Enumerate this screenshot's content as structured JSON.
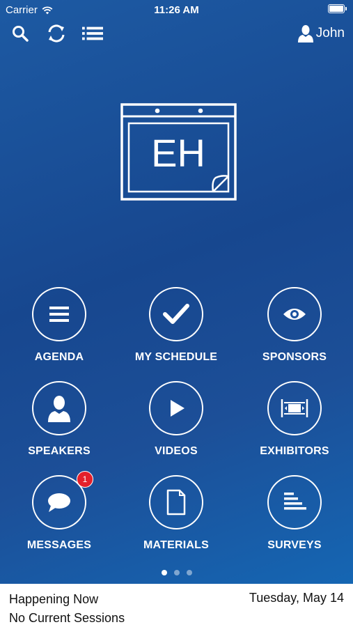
{
  "status_bar": {
    "carrier": "Carrier",
    "time": "11:26 AM"
  },
  "nav": {
    "search_icon": "search-icon",
    "refresh_icon": "refresh-icon",
    "list_icon": "list-icon",
    "user_name": "John"
  },
  "logo": {
    "text": "EH"
  },
  "tiles": [
    {
      "label": "AGENDA",
      "icon": "agenda-icon"
    },
    {
      "label": "MY SCHEDULE",
      "icon": "checkmark-icon"
    },
    {
      "label": "SPONSORS",
      "icon": "eye-icon"
    },
    {
      "label": "SPEAKERS",
      "icon": "person-icon"
    },
    {
      "label": "VIDEOS",
      "icon": "play-icon"
    },
    {
      "label": "EXHIBITORS",
      "icon": "booth-icon"
    },
    {
      "label": "MESSAGES",
      "icon": "chat-bubble-icon",
      "badge": "1"
    },
    {
      "label": "MATERIALS",
      "icon": "document-icon"
    },
    {
      "label": "SURVEYS",
      "icon": "survey-lines-icon"
    }
  ],
  "pager": {
    "pages": 3,
    "current": 1
  },
  "footer": {
    "title": "Happening Now",
    "date": "Tuesday, May 14",
    "subtitle": "No Current Sessions"
  },
  "colors": {
    "background_top": "#1d5aa3",
    "background_bottom": "#1566b3",
    "badge": "#e4202b",
    "footer_bg": "#ffffff"
  }
}
